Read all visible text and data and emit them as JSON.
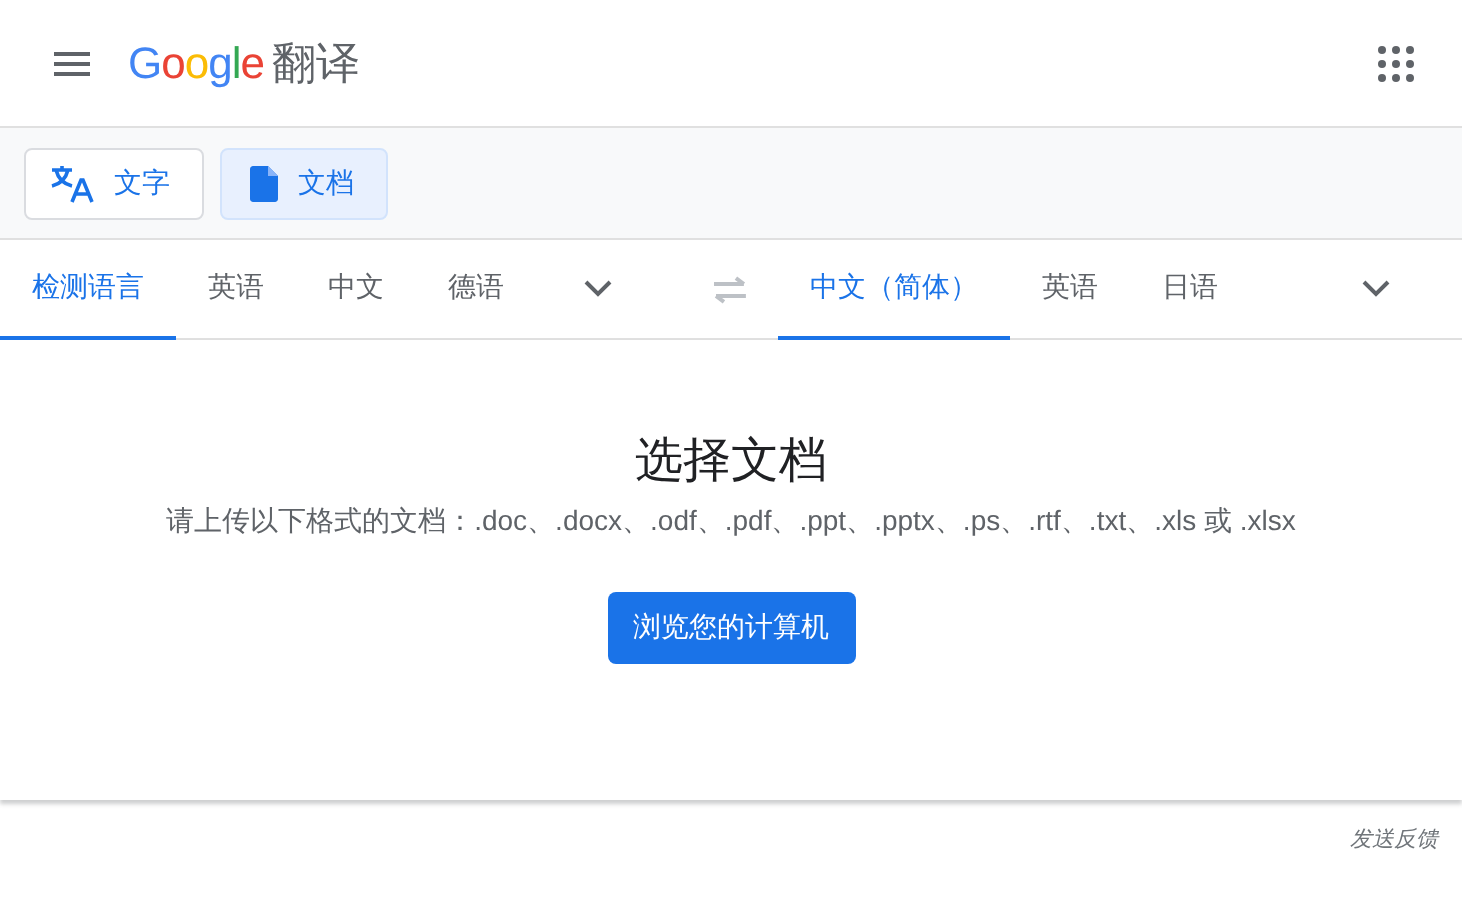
{
  "header": {
    "logo": "Google",
    "title": "翻译"
  },
  "modes": [
    {
      "label": "文字",
      "kind": "text",
      "selected": false
    },
    {
      "label": "文档",
      "kind": "document",
      "selected": true
    }
  ],
  "source_languages": [
    {
      "label": "检测语言",
      "selected": true
    },
    {
      "label": "英语",
      "selected": false
    },
    {
      "label": "中文",
      "selected": false
    },
    {
      "label": "德语",
      "selected": false
    }
  ],
  "target_languages": [
    {
      "label": "中文（简体）",
      "selected": true
    },
    {
      "label": "英语",
      "selected": false
    },
    {
      "label": "日语",
      "selected": false
    }
  ],
  "upload": {
    "title": "选择文档",
    "hint": "请上传以下格式的文档：.doc、.docx、.odf、.pdf、.ppt、.pptx、.ps、.rtf、.txt、.xls 或 .xlsx",
    "button": "浏览您的计算机"
  },
  "feedback": "发送反馈"
}
